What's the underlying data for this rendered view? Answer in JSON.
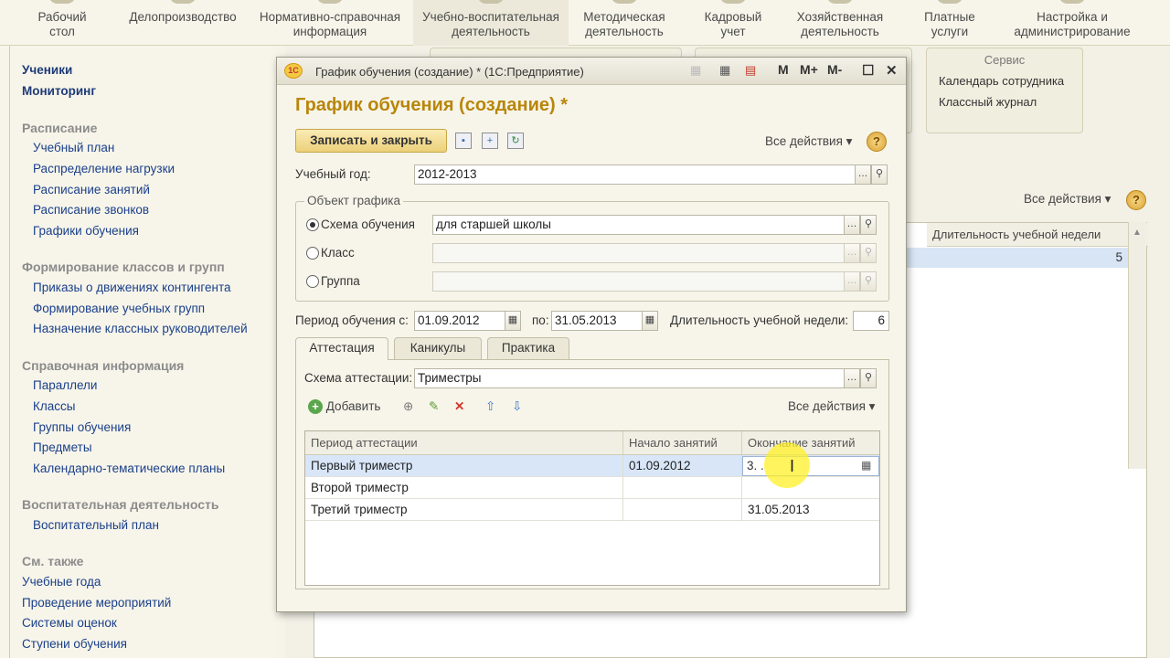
{
  "top_sections": [
    {
      "label": "Рабочий\nстол",
      "l1": "Рабочий",
      "l2": "стол"
    },
    {
      "l1": "Делопроизводство",
      "l2": ""
    },
    {
      "l1": "Нормативно-справочная",
      "l2": "информация"
    },
    {
      "l1": "Учебно-воспитательная",
      "l2": "деятельность"
    },
    {
      "l1": "Методическая",
      "l2": "деятельность"
    },
    {
      "l1": "Кадровый",
      "l2": "учет"
    },
    {
      "l1": "Хозяйственная",
      "l2": "деятельность"
    },
    {
      "l1": "Платные",
      "l2": "услуги"
    },
    {
      "l1": "Настройка и",
      "l2": "администрирование"
    }
  ],
  "leftnav": {
    "top_items": [
      "Ученики",
      "Мониторинг"
    ],
    "groups": [
      {
        "title": "Расписание",
        "items": [
          "Учебный план",
          "Распределение нагрузки",
          "Расписание занятий",
          "Расписание звонков",
          "Графики обучения"
        ]
      },
      {
        "title": "Формирование классов и групп",
        "items": [
          "Приказы о движениях контингента",
          "Формирование учебных групп",
          "Назначение классных руководителей"
        ]
      },
      {
        "title": "Справочная информация",
        "items": [
          "Параллели",
          "Классы",
          "Группы обучения",
          "Предметы",
          "Календарно-тематические планы"
        ]
      },
      {
        "title": "Воспитательная деятельность",
        "items": [
          "Воспитательный план"
        ]
      },
      {
        "title": "См. также",
        "items": [
          "Учебные года",
          "Проведение мероприятий",
          "Системы оценок",
          "Ступени обучения"
        ]
      }
    ]
  },
  "background": {
    "service_panel": {
      "title": "Сервис",
      "links": [
        "Календарь сотрудника",
        "Классный журнал"
      ]
    },
    "all_actions": "Все действия",
    "table": {
      "col_header": "Длительность учебной недели",
      "row_value": "5"
    }
  },
  "dialog": {
    "window_title": "График обучения (создание) * (1С:Предприятие)",
    "logo_text": "1С",
    "form_title": "График обучения (создание) *",
    "save_close_label": "Записать и закрыть",
    "all_actions": "Все действия",
    "help": "?",
    "school_year_label": "Учебный год:",
    "school_year_value": "2012-2013",
    "object_group_title": "Объект графика",
    "radio_scheme_label": "Схема обучения",
    "radio_scheme_value": "для старшей школы",
    "radio_class_label": "Класс",
    "radio_group_label": "Группа",
    "period_from_label": "Период обучения с:",
    "period_from_value": "01.09.2012",
    "period_to_label": "по:",
    "period_to_value": "31.05.2013",
    "week_length_label": "Длительность учебной недели:",
    "week_length_value": "6",
    "tabs": [
      "Аттестация",
      "Каникулы",
      "Практика"
    ],
    "attestation_scheme_label": "Схема аттестации:",
    "attestation_scheme_value": "Триместры",
    "add_label": "Добавить",
    "table_all_actions": "Все действия",
    "columns": [
      "Период аттестации",
      "Начало занятий",
      "Окончание занятий"
    ],
    "rows": [
      {
        "period": "Первый триместр",
        "start": "01.09.2012",
        "end": "3.  .  "
      },
      {
        "period": "Второй триместр",
        "start": "",
        "end": ""
      },
      {
        "period": "Третий триместр",
        "start": "",
        "end": "31.05.2013"
      }
    ]
  }
}
